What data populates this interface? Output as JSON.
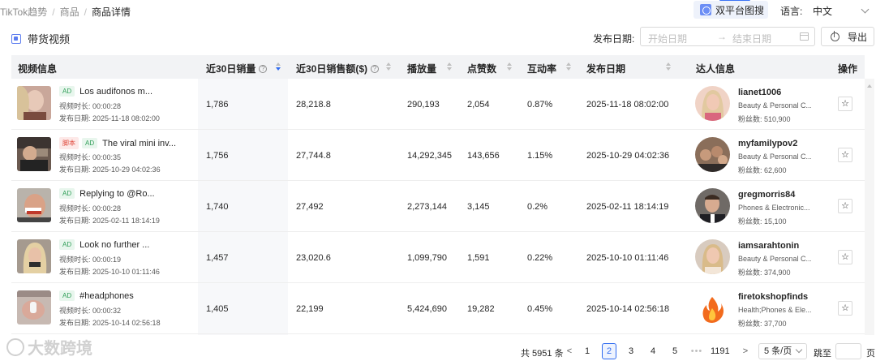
{
  "breadcrumb": [
    "TikTok趋势",
    "商品",
    "商品详情"
  ],
  "top": {
    "dual_platform_label": "双平台图搜",
    "language_label": "语言:",
    "language_value": "中文"
  },
  "section": {
    "title": "带货视频",
    "date_label": "发布日期:",
    "start_placeholder": "开始日期",
    "end_placeholder": "结束日期",
    "export_label": "导出"
  },
  "columns": [
    "视频信息",
    "近30日销量",
    "近30日销售额($)",
    "播放量",
    "点赞数",
    "互动率",
    "发布日期",
    "达人信息",
    "操作"
  ],
  "rows": [
    {
      "tags": [
        "AD"
      ],
      "title": "Los audifonos m...",
      "duration": "视频时长: 00:00:28",
      "published": "发布日期: 2025-11-18 08:02:00",
      "sales30": "1,786",
      "revenue30": "28,218.8",
      "views": "290,193",
      "likes": "2,054",
      "engagement": "0.87%",
      "date": "2025-11-18 08:02:00",
      "creator": "lianet1006",
      "category": "Beauty & Personal C...",
      "fans": "粉丝数: 510,900"
    },
    {
      "tags": [
        "脚本",
        "AD"
      ],
      "title": "The viral mini inv...",
      "duration": "视频时长: 00:00:35",
      "published": "发布日期: 2025-10-29 04:02:36",
      "sales30": "1,756",
      "revenue30": "27,744.8",
      "views": "14,292,345",
      "likes": "143,656",
      "engagement": "1.15%",
      "date": "2025-10-29 04:02:36",
      "creator": "myfamilypov2",
      "category": "Beauty & Personal C...",
      "fans": "粉丝数: 62,600"
    },
    {
      "tags": [
        "AD"
      ],
      "title": "Replying to @Ro...",
      "duration": "视频时长: 00:00:28",
      "published": "发布日期: 2025-02-11 18:14:19",
      "sales30": "1,740",
      "revenue30": "27,492",
      "views": "2,273,144",
      "likes": "3,145",
      "engagement": "0.2%",
      "date": "2025-02-11 18:14:19",
      "creator": "gregmorris84",
      "category": "Phones & Electronic...",
      "fans": "粉丝数: 15,100"
    },
    {
      "tags": [
        "AD"
      ],
      "title": "Look no further ...",
      "duration": "视频时长: 00:00:19",
      "published": "发布日期: 2025-10-10 01:11:46",
      "sales30": "1,457",
      "revenue30": "23,020.6",
      "views": "1,099,790",
      "likes": "1,591",
      "engagement": "0.22%",
      "date": "2025-10-10 01:11:46",
      "creator": "iamsarahtonin",
      "category": "Beauty & Personal C...",
      "fans": "粉丝数: 374,900"
    },
    {
      "tags": [
        "AD"
      ],
      "title": "#headphones",
      "duration": "视频时长: 00:00:32",
      "published": "发布日期: 2025-10-14 02:56:18",
      "sales30": "1,405",
      "revenue30": "22,199",
      "views": "5,424,690",
      "likes": "19,282",
      "engagement": "0.45%",
      "date": "2025-10-14 02:56:18",
      "creator": "firetokshopfinds",
      "category": "Health;Phones & Ele...",
      "fans": "粉丝数: 37,700"
    }
  ],
  "pagination": {
    "total": "共 5951 条",
    "prev": "<",
    "pages": [
      "1",
      "2",
      "3",
      "4",
      "5"
    ],
    "ellipsis": "•••",
    "last": "1191",
    "next": ">",
    "page_size": "5 条/页",
    "jump_label": "跳至",
    "jump_suffix": "页"
  },
  "watermark": "大数跨境",
  "colors": {
    "accent": "#2f6bf0",
    "ad_green": "#2f9e57",
    "script_red": "#e0493c"
  }
}
